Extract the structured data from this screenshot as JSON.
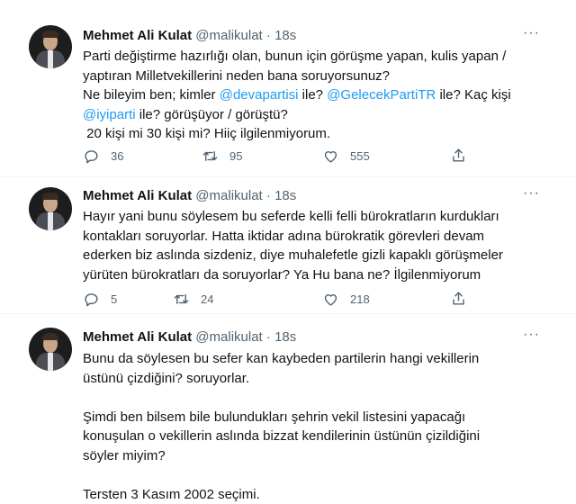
{
  "tweets": [
    {
      "author": "Mehmet Ali Kulat",
      "handle": "@malikulat",
      "dot": "·",
      "time": "18s",
      "more": "···",
      "segments": [
        {
          "t": "Parti değiştirme hazırlığı olan, bunun için görüşme yapan, kulis yapan / yaptıran Milletvekillerini neden bana soruyorsunuz?\nNe bileyim ben; kimler ",
          "m": false
        },
        {
          "t": "@devapartisi",
          "m": true
        },
        {
          "t": " ile? ",
          "m": false
        },
        {
          "t": "@GelecekPartiTR",
          "m": true
        },
        {
          "t": " ile? Kaç kişi\n",
          "m": false
        },
        {
          "t": "@iyiparti",
          "m": true
        },
        {
          "t": " ile? görüşüyor / görüştü?\n 20 kişi mi 30 kişi mi? Hiiç ilgilenmiyorum.",
          "m": false
        }
      ],
      "replies": "36",
      "retweets": "95",
      "likes": "555"
    },
    {
      "author": "Mehmet Ali Kulat",
      "handle": "@malikulat",
      "dot": "·",
      "time": "18s",
      "more": "···",
      "segments": [
        {
          "t": "Hayır yani bunu söylesem bu seferde kelli felli bürokratların kurdukları kontakları soruyorlar. Hatta iktidar adına bürokratik görevleri devam ederken biz aslında sizdeniz, diye muhalefetle gizli kapaklı görüşmeler yürüten bürokratları da soruyorlar? Ya Hu bana ne? İlgilenmiyorum",
          "m": false
        }
      ],
      "replies": "5",
      "retweets": "24",
      "likes": "218"
    },
    {
      "author": "Mehmet Ali Kulat",
      "handle": "@malikulat",
      "dot": "·",
      "time": "18s",
      "more": "···",
      "segments": [
        {
          "t": "Bunu da söylesen bu sefer kan kaybeden partilerin hangi vekillerin üstünü çizdiğini? soruyorlar.\n\nŞimdi ben bilsem bile bulundukları şehrin vekil listesini yapacağı konuşulan o vekillerin aslında bizzat kendilerinin üstünün çizildiğini söyler miyim?\n\nTersten 3 Kasım 2002 seçimi.",
          "m": false
        }
      ],
      "replies": "",
      "retweets": "",
      "likes": ""
    }
  ],
  "icons": {
    "reply": "reply-icon",
    "retweet": "retweet-icon",
    "like": "like-icon",
    "share": "share-icon",
    "more": "more-options-icon"
  },
  "colors": {
    "mention": "#1d9bf0",
    "secondary_text": "#536471",
    "text": "#0f1419"
  }
}
